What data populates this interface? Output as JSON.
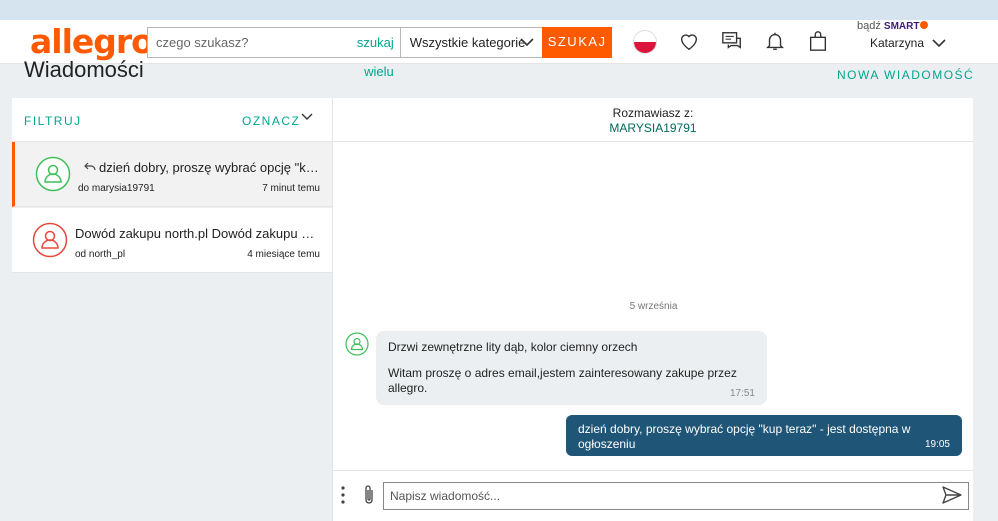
{
  "header": {
    "logo": "allegro",
    "search_placeholder": "czego szukasz?",
    "search_multi": "szukaj wielu",
    "category": "Wszystkie kategorie",
    "search_button": "SZUKAJ",
    "smart_prefix": "bądź",
    "smart_label": "SMART",
    "user_name": "Katarzyna"
  },
  "page": {
    "title": "Wiadomości",
    "new_message": "NOWA WIADOMOŚĆ"
  },
  "threads_panel": {
    "filter": "FILTRUJ",
    "mark": "OZNACZ",
    "threads": [
      {
        "subject": "dzień dobry, proszę wybrać opcję \"kup teraz\" - jest dostępna w ogłoszeniu",
        "who": "do marysia19791",
        "when": "7 minut temu",
        "avatar_color": "#3fbf5a"
      },
      {
        "subject": "Dowód zakupu north.pl Dowód zakupu Dowód zakupu",
        "who": "od north_pl",
        "when": "4 miesiące temu",
        "avatar_color": "#e8463c"
      }
    ]
  },
  "conversation": {
    "with_label": "Rozmawiasz z:",
    "with_user": "MARYSIA19791",
    "date_separator": "5 września",
    "incoming": {
      "line1": "Drzwi zewnętrzne lity dąb, kolor ciemny orzech",
      "line2": "Witam proszę o adres email,jestem zainteresowany zakupe przez allegro.",
      "time": "17:51"
    },
    "outgoing": {
      "text": "dzień dobry, proszę wybrać opcję \"kup teraz\" - jest dostępna w ogłoszeniu",
      "time": "19:05"
    },
    "composer_placeholder": "Napisz wiadomość..."
  },
  "colors": {
    "brand": "#ff5a00",
    "accent": "#00a790",
    "outgoing_bubble": "#1f5576"
  }
}
